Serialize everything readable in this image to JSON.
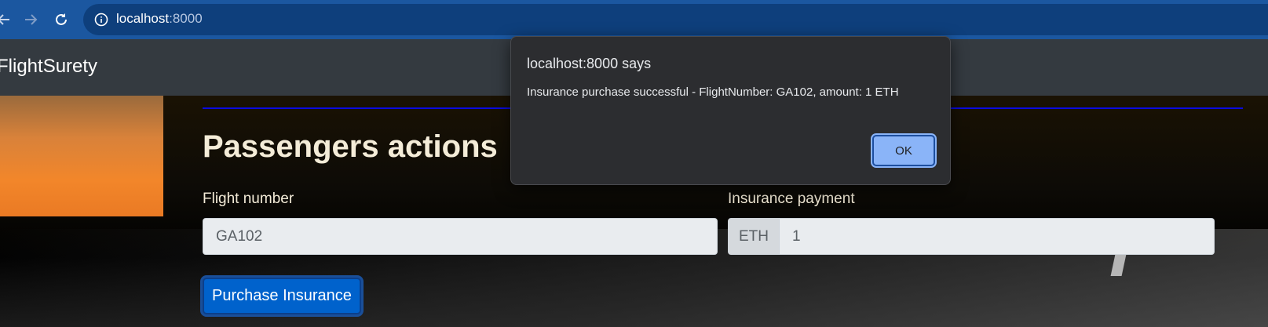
{
  "browser": {
    "url_host": "localhost",
    "url_port": ":8000"
  },
  "navbar": {
    "brand": "FlightSurety"
  },
  "main": {
    "title": "Passengers actions",
    "flight_label": "Flight number",
    "flight_value": "GA102",
    "payment_label": "Insurance payment",
    "payment_addon": "ETH",
    "payment_value": "1",
    "purchase_button": "Purchase Insurance"
  },
  "dialog": {
    "title": "localhost:8000 says",
    "message": "Insurance purchase successful - FlightNumber: GA102, amount: 1 ETH",
    "ok_label": "OK"
  },
  "colors": {
    "browser_bar": "#1b57a0",
    "navbar": "#343a40",
    "primary_button": "#0062cc",
    "dialog_bg": "#2c2d30",
    "dialog_button": "#8ab4f8"
  },
  "icons": [
    "back-icon",
    "forward-icon",
    "reload-icon",
    "info-icon"
  ]
}
